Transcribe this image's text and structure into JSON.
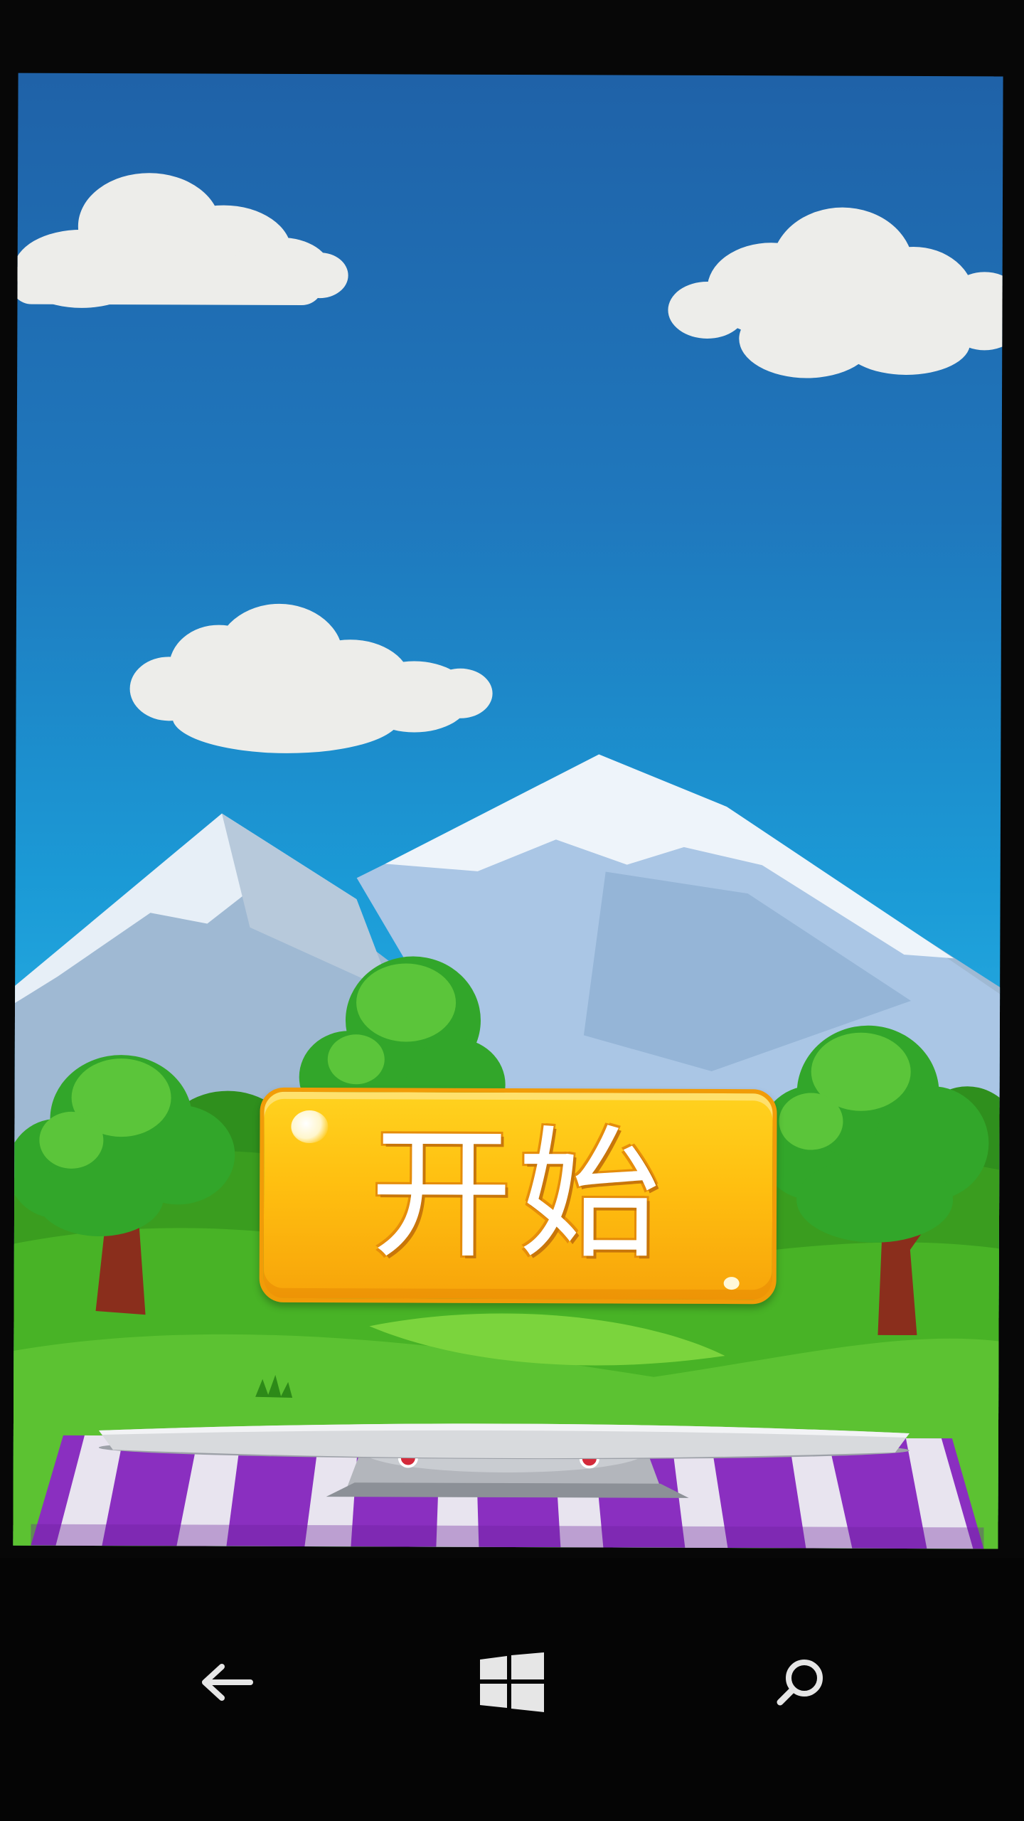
{
  "game": {
    "start_label": "开始"
  },
  "navbar": {
    "back_icon": "back-arrow-icon",
    "home_icon": "windows-logo-icon",
    "search_icon": "search-icon"
  },
  "colors": {
    "sky_top": "#1f62a8",
    "sky_bottom": "#5bbde4",
    "button_fill": "#ffc010",
    "grass": "#3fae21",
    "tablecloth_purple": "#8a2fc0"
  }
}
